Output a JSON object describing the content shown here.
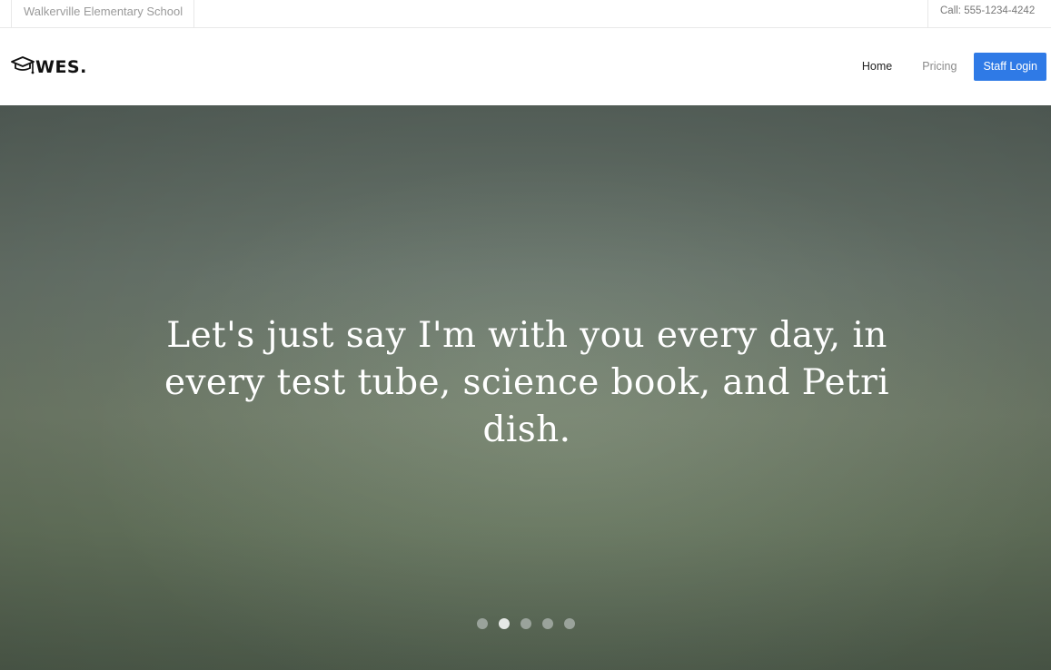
{
  "topbar": {
    "school_name": "Walkerville Elementary School",
    "phone": "Call: 555-1234-4242"
  },
  "logo": {
    "icon": "graduation-cap-icon",
    "text": "WES."
  },
  "nav": {
    "items": [
      {
        "label": "Home",
        "active": true
      },
      {
        "label": "Pricing",
        "active": false
      }
    ],
    "cta_label": "Staff Login",
    "cta_color": "#2f7ae6"
  },
  "hero": {
    "quote": "Let's just say I'm with you every day, in every test tube, science book, and Petri dish.",
    "slides_total": 5,
    "active_slide": 2
  }
}
